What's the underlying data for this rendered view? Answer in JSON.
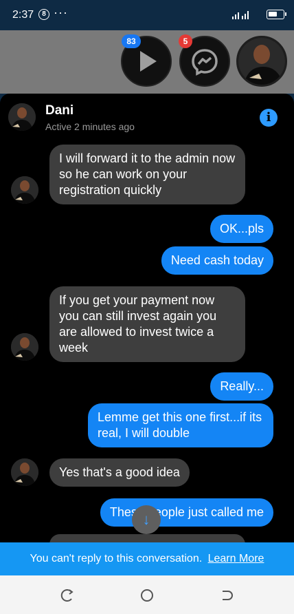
{
  "status_bar": {
    "time": "2:37",
    "notification_badge": "8",
    "more": "···"
  },
  "chat_heads": {
    "video_count": "83",
    "messenger_count": "5"
  },
  "conversation": {
    "contact_name": "Dani",
    "contact_status": "Active 2 minutes ago",
    "messages": [
      {
        "from": "them",
        "text": "I will forward it to the admin now so he can work on your registration quickly"
      },
      {
        "from": "me",
        "text": "OK...pls"
      },
      {
        "from": "me",
        "text": "Need cash today"
      },
      {
        "from": "them",
        "text": "If you get your payment now you can still invest again you are allowed to invest twice a week"
      },
      {
        "from": "me",
        "text": "Really..."
      },
      {
        "from": "me",
        "text": "Lemme get this one first...if its real, I will double"
      },
      {
        "from": "them",
        "text": "Yes that's a good idea"
      },
      {
        "from": "me",
        "text": "These people just called me"
      }
    ]
  },
  "reply_bar": {
    "text": "You can't reply to this conversation.",
    "link": "Learn More"
  },
  "colors": {
    "accent": "#1485f5",
    "incoming": "#3e3e3e",
    "banner": "#1597f3"
  }
}
